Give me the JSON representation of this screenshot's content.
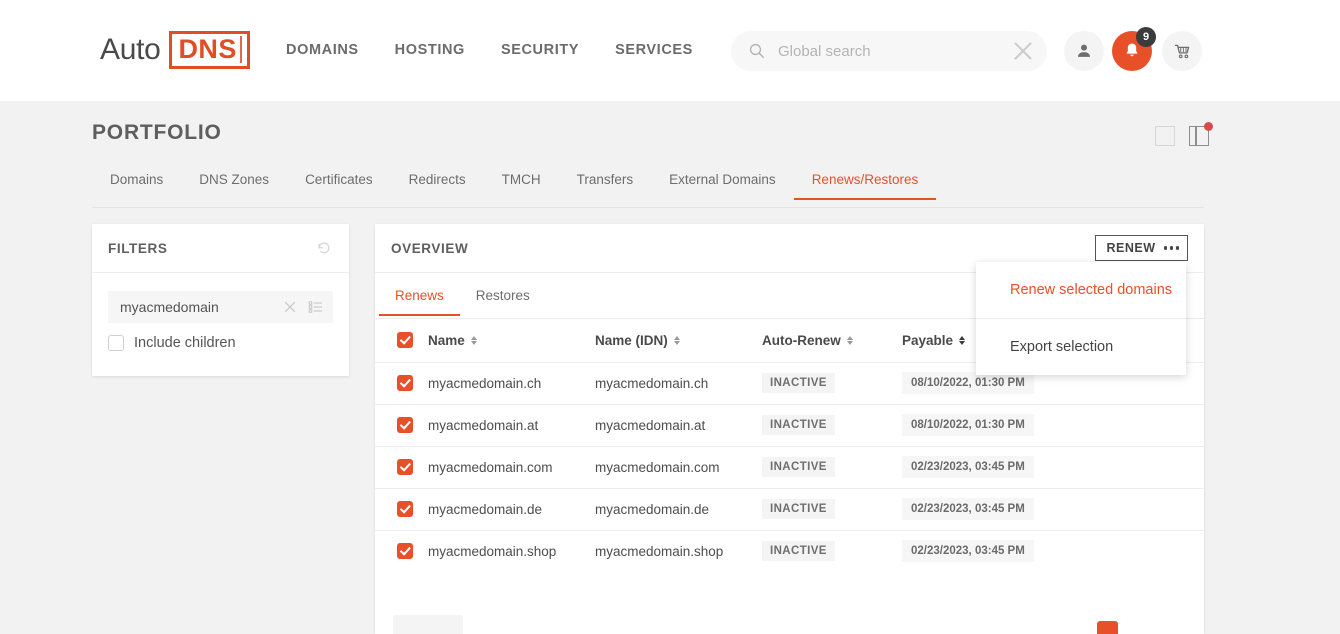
{
  "header": {
    "logo": {
      "auto": "Auto",
      "dns": "DNS"
    },
    "nav": [
      {
        "label": "DOMAINS"
      },
      {
        "label": "HOSTING"
      },
      {
        "label": "SECURITY"
      },
      {
        "label": "SERVICES"
      }
    ],
    "search": {
      "value": "",
      "placeholder": "Global search"
    },
    "notifications_count": "9",
    "icons": {
      "user": "user-icon",
      "bell": "bell-icon",
      "cart": "cart-icon",
      "search": "search-icon",
      "clear": "close-icon"
    }
  },
  "page": {
    "title": "PORTFOLIO",
    "tabs": [
      {
        "label": "Domains",
        "active": false
      },
      {
        "label": "DNS Zones",
        "active": false
      },
      {
        "label": "Certificates",
        "active": false
      },
      {
        "label": "Redirects",
        "active": false
      },
      {
        "label": "TMCH",
        "active": false
      },
      {
        "label": "Transfers",
        "active": false
      },
      {
        "label": "External Domains",
        "active": false
      },
      {
        "label": "Renews/Restores",
        "active": true
      }
    ]
  },
  "filters": {
    "title": "FILTERS",
    "reset_icon": "reset-icon",
    "query": {
      "value": "myacmedomain",
      "placeholder": ""
    },
    "include_children": {
      "label": "Include children",
      "checked": false
    }
  },
  "overview": {
    "title": "OVERVIEW",
    "renew_button": {
      "label": "RENEW"
    },
    "sub_tabs": [
      {
        "label": "Renews",
        "active": true
      },
      {
        "label": "Restores",
        "active": false
      }
    ],
    "table": {
      "header_checkbox_checked": true,
      "columns": [
        {
          "label": "Name",
          "sort": "none"
        },
        {
          "label": "Name (IDN)",
          "sort": "none"
        },
        {
          "label": "Auto-Renew",
          "sort": "none"
        },
        {
          "label": "Payable",
          "sort": "asc"
        }
      ],
      "rows": [
        {
          "checked": true,
          "name": "myacmedomain.ch",
          "idn": "myacmedomain.ch",
          "auto_renew": "INACTIVE",
          "payable": "08/10/2022, 01:30 PM"
        },
        {
          "checked": true,
          "name": "myacmedomain.at",
          "idn": "myacmedomain.at",
          "auto_renew": "INACTIVE",
          "payable": "08/10/2022, 01:30 PM"
        },
        {
          "checked": true,
          "name": "myacmedomain.com",
          "idn": "myacmedomain.com",
          "auto_renew": "INACTIVE",
          "payable": "02/23/2023, 03:45 PM"
        },
        {
          "checked": true,
          "name": "myacmedomain.de",
          "idn": "myacmedomain.de",
          "auto_renew": "INACTIVE",
          "payable": "02/23/2023, 03:45 PM"
        },
        {
          "checked": true,
          "name": "myacmedomain.shop",
          "idn": "myacmedomain.shop",
          "auto_renew": "INACTIVE",
          "payable": "02/23/2023, 03:45 PM"
        }
      ]
    }
  },
  "dropdown": {
    "items": [
      {
        "label": "Renew selected domains",
        "accent": true
      },
      {
        "label": "Export selection",
        "accent": false
      }
    ]
  },
  "colors": {
    "accent": "#e8502a",
    "logo_border": "#e04e25",
    "page_background": "#f2f2f2",
    "badge_dark": "#3c3c3c",
    "view_badge_red": "#d94b4b"
  }
}
